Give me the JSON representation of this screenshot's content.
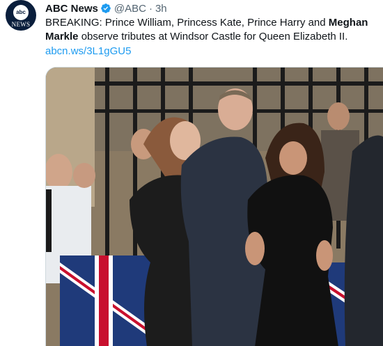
{
  "account": {
    "avatar_icon": "abc-news-logo-icon",
    "avatar_logo_text": "abc",
    "avatar_word": "NEWS",
    "name": "ABC News",
    "verified_icon": "verified-badge-icon",
    "handle": "@ABC",
    "separator": "·",
    "time": "3h"
  },
  "tweet": {
    "text_before": "BREAKING: Prince William, Princess Kate, Prince Harry and ",
    "text_bold": "Meghan Markle",
    "text_after": " observe tributes at Windsor Castle for Queen Elizabeth II.",
    "link": "abcn.ws/3L1gGU5"
  },
  "colors": {
    "link": "#1d9bf0",
    "verified": "#1d9bf0",
    "avatar_bg": "#0a1e3c",
    "muted": "#536471"
  }
}
